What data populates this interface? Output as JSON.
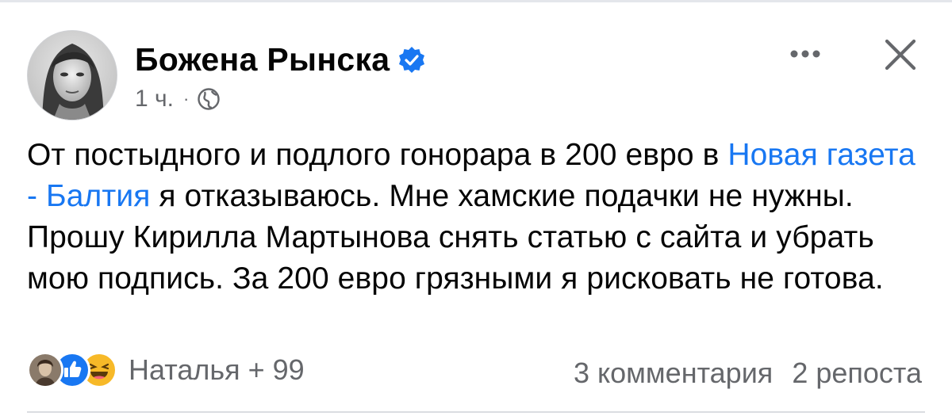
{
  "post": {
    "author": "Божена Рынска",
    "time": "1 ч.",
    "separator": "·",
    "body": {
      "part1": "От постыдного и подлого гонорара в 200 евро в ",
      "link": "Новая газета - Балтия",
      "part2": " я отказываюсь. Мне хамские подачки не нужны. Прошу Кирилла Мартынова снять статью с сайта и убрать мою подпись. За 200 евро грязными я рисковать не готова."
    },
    "reactions": {
      "icons": [
        "avatar-reactor",
        "like-icon",
        "haha-icon"
      ],
      "summary": "Наталья + 99"
    },
    "comments": "3 комментария",
    "shares": "2 репоста"
  },
  "header": {
    "more_icon": "more-icon",
    "close_icon": "close-icon",
    "verified_icon": "verified-badge-icon",
    "privacy_icon": "globe-icon"
  },
  "colors": {
    "link": "#1877f2",
    "verified": "#1877f2",
    "secondary_text": "#65676b",
    "like": "#1877f2",
    "haha": "#f7b928"
  }
}
